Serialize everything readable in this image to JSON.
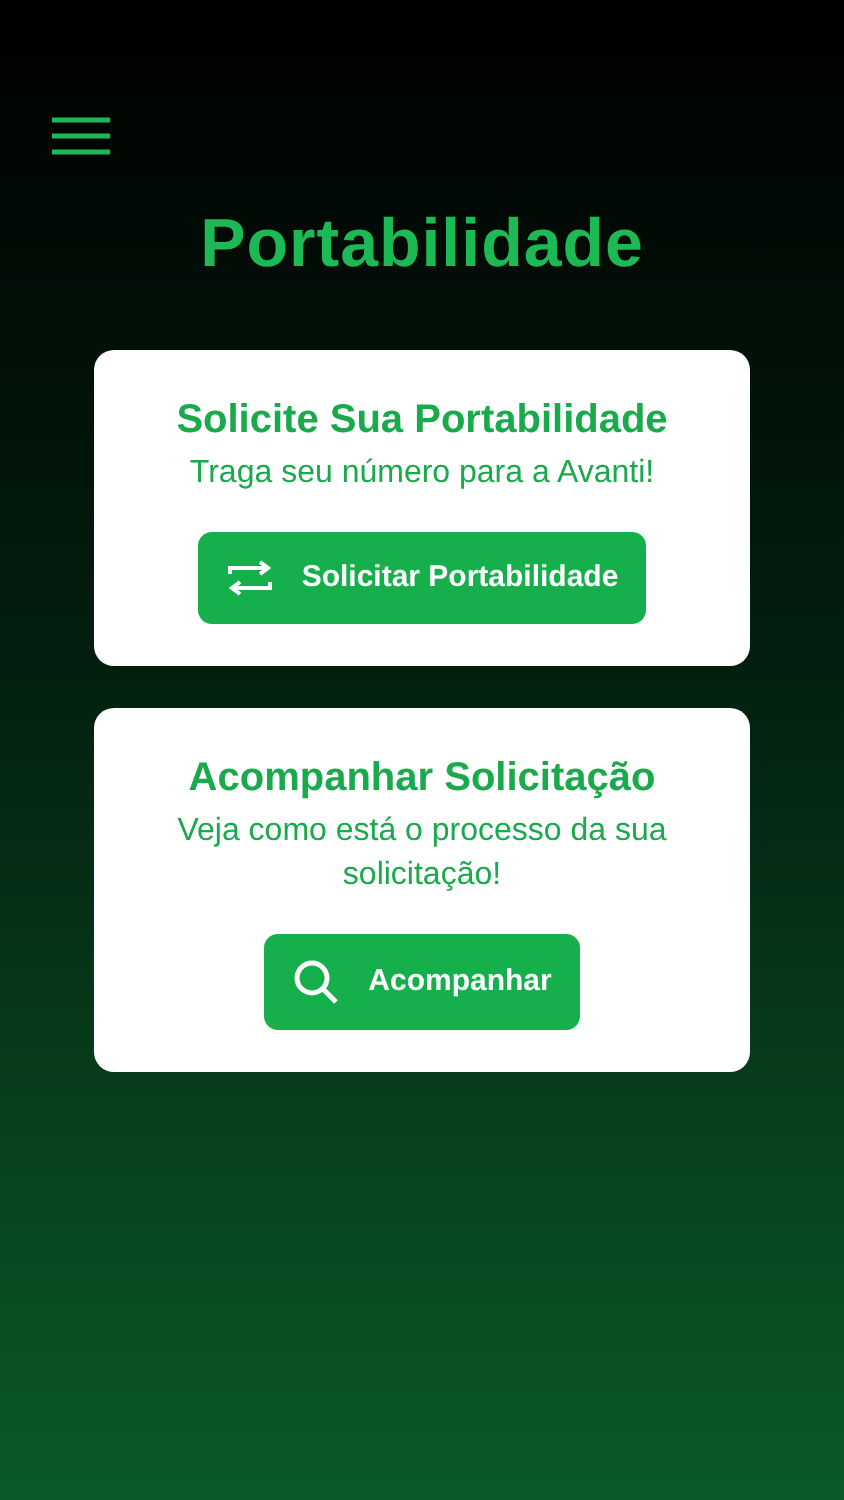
{
  "title": "Portabilidade",
  "cards": [
    {
      "heading": "Solicite Sua Portabilidade",
      "text": "Traga seu número para a Avanti!",
      "button": {
        "label": "Solicitar Portabilidade",
        "kind": "swap"
      }
    },
    {
      "heading": "Acompanhar Solicitação",
      "text": "Veja como está o processo da sua solicitação!",
      "button": {
        "label": "Acompanhar",
        "kind": "search"
      }
    }
  ]
}
